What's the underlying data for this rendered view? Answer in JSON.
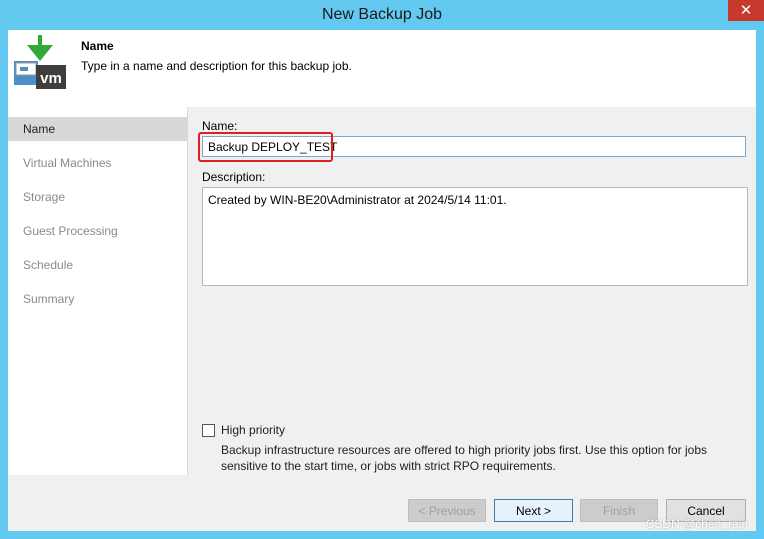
{
  "window": {
    "title": "New Backup Job",
    "close_glyph": "✕"
  },
  "header": {
    "icon": "vm-backup-icon",
    "title": "Name",
    "description": "Type in a name and description for this backup job.",
    "icon_text": "vm"
  },
  "sidebar": {
    "items": [
      {
        "label": "Name",
        "active": true
      },
      {
        "label": "Virtual Machines",
        "active": false
      },
      {
        "label": "Storage",
        "active": false
      },
      {
        "label": "Guest Processing",
        "active": false
      },
      {
        "label": "Schedule",
        "active": false
      },
      {
        "label": "Summary",
        "active": false
      }
    ]
  },
  "form": {
    "name_label": "Name:",
    "name_value": "Backup DEPLOY_TEST",
    "description_label": "Description:",
    "description_value": "Created by WIN-BE20\\Administrator at 2024/5/14 11:01.",
    "high_priority_label": "High priority",
    "high_priority_checked": false,
    "high_priority_help": "Backup infrastructure resources are offered to high priority jobs first. Use this option for jobs sensitive to the start time, or jobs with strict RPO requirements."
  },
  "buttons": {
    "previous": "< Previous",
    "next": "Next >",
    "finish": "Finish",
    "cancel": "Cancel"
  },
  "watermark": "CSDN @chen_rain",
  "colors": {
    "title_bar": "#63c9f0",
    "highlight_box": "#e02020",
    "close_button": "#c7382d",
    "active_nav": "#d7d7d7"
  }
}
